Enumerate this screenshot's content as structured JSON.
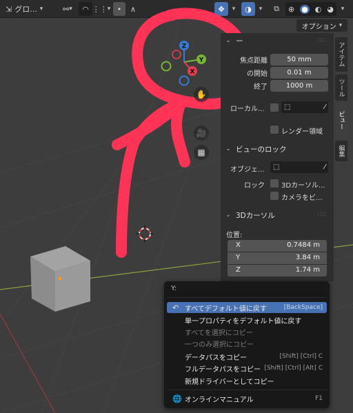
{
  "colors": {
    "viewport_bg": "#3d3d3d",
    "panel_bg": "#2e2e2e",
    "accent": "#4772b3",
    "annotation": "#ff3355",
    "x_axis": "#e83b50",
    "y_axis": "#79b536",
    "z_axis": "#3a7bd5"
  },
  "header": {
    "transform_orientation": "グロ...",
    "options_label": "オプション"
  },
  "gizmo": {
    "z": "Z",
    "y": "Y",
    "x": "X"
  },
  "panel": {
    "view_section_title": "ー",
    "focal_length_label": "焦点距離",
    "focal_length_value": "50 mm",
    "clip_start_label": "の開始",
    "clip_start_value": "0.01 m",
    "clip_end_label": "終了",
    "clip_end_value": "1000 m",
    "local_camera_label": "ローカル...",
    "render_region_label": "レンダー領域",
    "view_lock_title": "ビューのロック",
    "lock_object_label": "オブジェ...",
    "lock_label": "ロック",
    "lock_3d_cursor_label": "3Dカーソル...",
    "lock_camera_label": "カメラをビ...",
    "cursor_section_title": "3Dカーソル",
    "location_label": "位置:",
    "location": [
      {
        "axis": "X",
        "value": "0.7484 m"
      },
      {
        "axis": "Y",
        "value": "3.84 m"
      },
      {
        "axis": "Z",
        "value": "1.74 m"
      }
    ]
  },
  "tabs": {
    "item": "アイテム",
    "tool": "ツール",
    "view": "ビュー",
    "edit": "編集"
  },
  "menu": {
    "title": "Y:",
    "items": [
      {
        "label": "すべてデフォルト値に戻す",
        "shortcut": "[BackSpace]"
      },
      {
        "label": "単一プロパティをデフォルト値に戻す",
        "shortcut": ""
      },
      {
        "label": "すべてを選択にコピー",
        "shortcut": ""
      },
      {
        "label": "一つのみ選択にコピー",
        "shortcut": ""
      },
      {
        "label": "データパスをコピー",
        "shortcut": "[Shift] [Ctrl] C"
      },
      {
        "label": "フルデータパスをコピー",
        "shortcut": "[Shift] [Ctrl] [Alt] C"
      },
      {
        "label": "新規ドライバーとしてコピー",
        "shortcut": ""
      },
      {
        "label": "オンラインマニュアル",
        "shortcut": "F1"
      }
    ]
  }
}
